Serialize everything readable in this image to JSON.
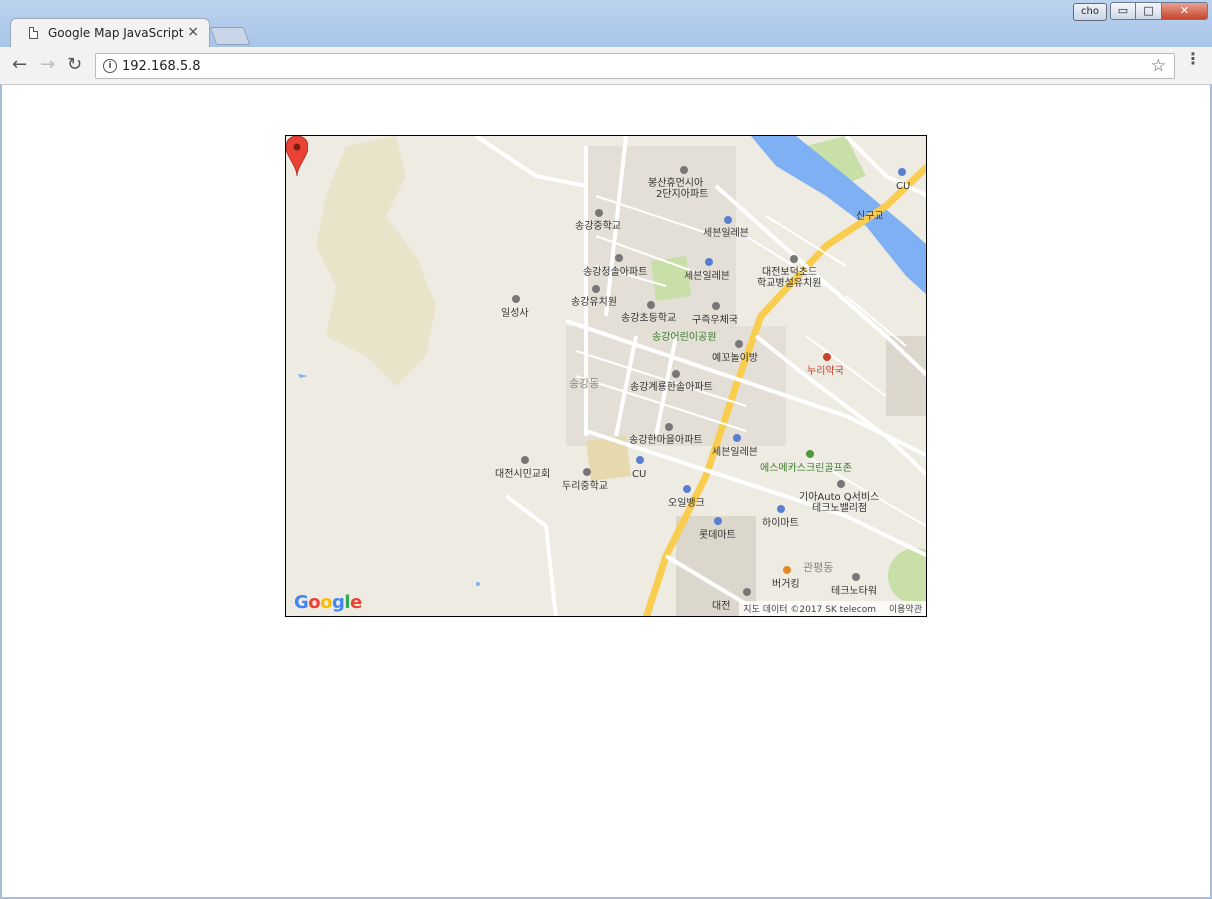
{
  "browser": {
    "tab_title": "Google Map JavaScript",
    "tab_close": "×",
    "user_badge": "cho",
    "address": "192.168.5.8",
    "info_glyph": "i",
    "star_glyph": "☆",
    "back_glyph": "←",
    "forward_glyph": "→",
    "reload_glyph": "↻",
    "menu_glyph": "⋮",
    "min_glyph": "▭",
    "max_glyph": "□",
    "close_glyph": "✕"
  },
  "map": {
    "labels": {
      "bongsan": "봉산휴먼시아",
      "bongsan2": "2단지아파트",
      "cu_top": "CU",
      "songgang_mid": "송강중학교",
      "seven_top": "세븐일레븐",
      "singu": "신구교",
      "songgang_apt": "송강청솔아파트",
      "seven_mid": "세븐일레븐",
      "daejeon_bodeok": "대전보덕초드",
      "hakgyo": "학교병설유치원",
      "ilseong": "일성사",
      "songgang_kinder": "송강유치원",
      "songgang_elem": "송강초등학교",
      "gujeuk_post": "구즉우체국",
      "songgang_park": "송강어린이공원",
      "yekkot": "예꼬놀이방",
      "nuri": "누리약국",
      "songgang_dong": "송강동",
      "songgang_gyeryong": "송강계룡한솔아파트",
      "songgang_hanmaeul": "송강한마을아파트",
      "seven_low": "세븐일레븐",
      "daejeon_church": "대전시민교회",
      "cu_mid": "CU",
      "duri_middle": "두리중학교",
      "s_mecca": "에스메카스크린골프존",
      "oil_bank": "오일뱅크",
      "kia_auto": "기아Auto Q서비스",
      "techno": "테크노밸리점",
      "himart": "하이마트",
      "lotte": "롯데마트",
      "gwanpyeong": "관평동",
      "burger": "버거킹",
      "techno_tower": "테크노타워",
      "daejeon_bottom": "대전"
    },
    "google_logo": [
      "G",
      "o",
      "o",
      "g",
      "l",
      "e"
    ],
    "credit_data": "지도 데이터 ©2017 SK telecom",
    "credit_terms": "이용약관",
    "colors": {
      "water": "#7fb0f3",
      "highway": "#f9cd4f",
      "road": "#ffffff",
      "land": "#eeebe3",
      "urban": "#e3dfd6",
      "park": "#c8dfa8",
      "hills": "#e9e3c9",
      "pin": "#ea4335"
    }
  }
}
